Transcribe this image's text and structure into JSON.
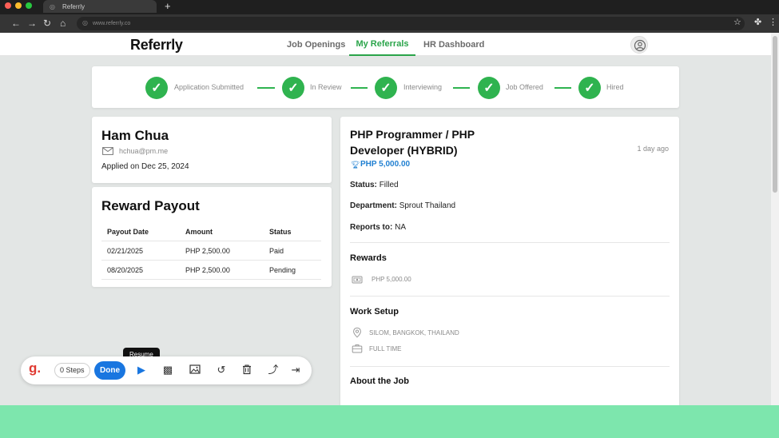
{
  "browser": {
    "tab_title": "Referrly",
    "new_tab": "+",
    "url": "www.referrly.co"
  },
  "header": {
    "logo": "Referrly",
    "nav": [
      "Job Openings",
      "My Referrals",
      "HR Dashboard"
    ],
    "active_nav": "My Referrals"
  },
  "progress": {
    "steps": [
      "Application Submitted",
      "In Review",
      "Interviewing",
      "Job Offered",
      "Hired"
    ],
    "completed": 5
  },
  "candidate": {
    "name": "Ham Chua",
    "email": "hchua@pm.me",
    "applied": "Applied on Dec 25, 2024"
  },
  "payout": {
    "title": "Reward Payout",
    "columns": [
      "Payout Date",
      "Amount",
      "Status"
    ],
    "rows": [
      [
        "02/21/2025",
        "PHP 2,500.00",
        "Paid"
      ],
      [
        "08/20/2025",
        "PHP 2,500.00",
        "Pending"
      ]
    ]
  },
  "job": {
    "title": "PHP Programmer / PHP Developer (HYBRID)",
    "posted": "1 day ago",
    "salary": "PHP 5,000.00",
    "status_label": "Status:",
    "status_value": "Filled",
    "department_label": "Department:",
    "department_value": "Sprout Thailand",
    "reports_label": "Reports to:",
    "reports_value": "NA",
    "rewards_title": "Rewards",
    "rewards_value": "PHP 5,000.00",
    "work_setup_title": "Work Setup",
    "location": "SILOM, BANGKOK, THAILAND",
    "employment": "FULL TIME",
    "about_title": "About the Job"
  },
  "toolbar": {
    "logo": "g.",
    "steps": "0 Steps",
    "done": "Done",
    "tooltip": "Resume",
    "icons": [
      "play-icon",
      "blur-icon",
      "image-icon",
      "undo-icon",
      "trash-icon",
      "arrow-up-icon",
      "skip-end-icon"
    ]
  },
  "colors": {
    "accent_green": "#2fb34f",
    "link_blue": "#1f7fd1",
    "done_blue": "#1976e0",
    "bottom_band": "#7de6ad"
  }
}
